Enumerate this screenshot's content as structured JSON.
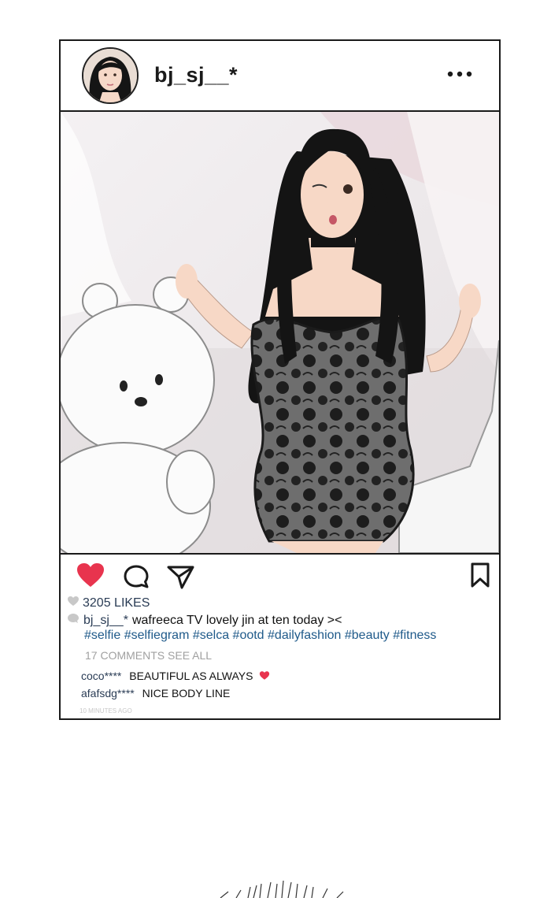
{
  "post": {
    "username": "bj_sj__*",
    "likes": "3205 LIKES",
    "caption_user": "bj_sj__*",
    "caption_text": "wafreeca TV lovely jin at ten today ><",
    "hashtags": "#selfie #selfiegram #selca #ootd #dailyfashion #beauty #fitness",
    "comments_link": "17 COMMENTS SEE ALL",
    "comments": [
      {
        "user": "coco****",
        "text": "BEAUTIFUL AS ALWAYS",
        "emoji": "heart-emoji"
      },
      {
        "user": "afafsdg****",
        "text": "NICE BODY LINE"
      }
    ],
    "timestamp": "10 MINUTES AGO"
  },
  "icons": {
    "more": "more-dots-icon",
    "like": "heart-icon",
    "comment": "comment-bubble-icon",
    "share": "paper-plane-icon",
    "save": "bookmark-icon",
    "likes_marker": "heart-outline-icon",
    "caption_marker": "bubble-outline-icon"
  },
  "colors": {
    "heart": "#e8344e",
    "hashtag": "#1f5a8a",
    "border": "#1a1a1a",
    "muted": "#a0a0a0"
  }
}
